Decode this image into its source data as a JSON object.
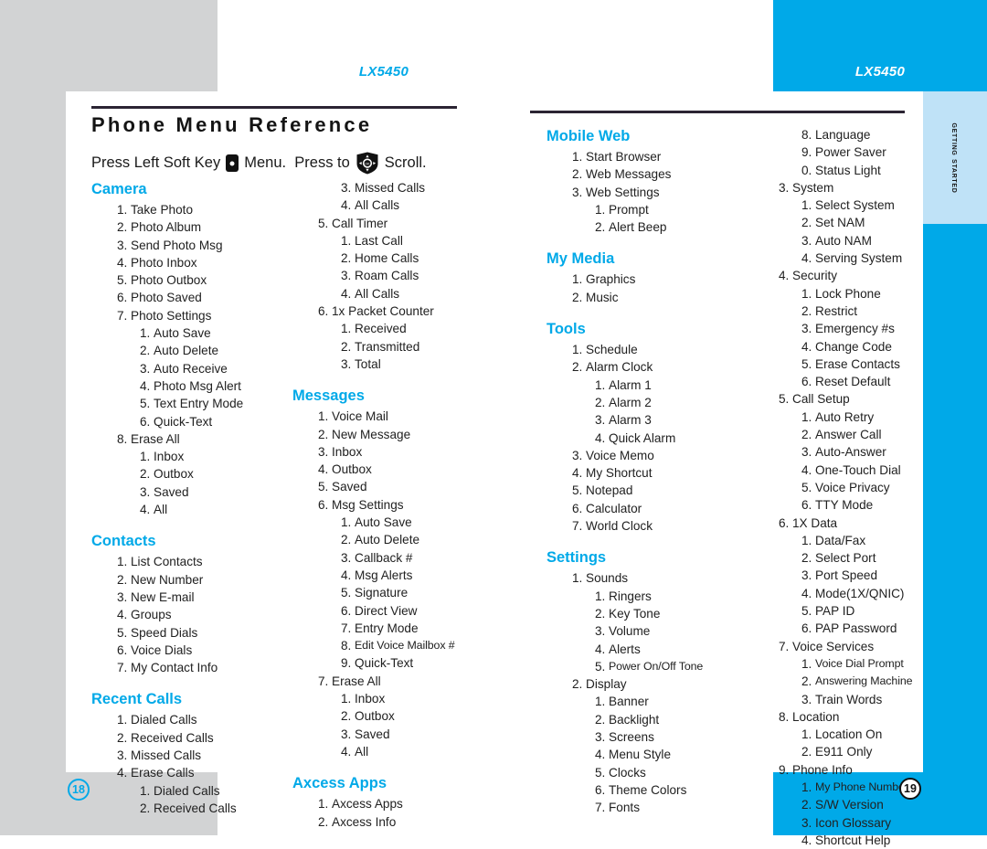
{
  "document": {
    "title": "Phone Menu Reference",
    "header_left": "LX5450",
    "header_right": "LX5450",
    "side_tab": "Getting Started",
    "page_left": "18",
    "page_right": "19",
    "accent_color": "#00a9e8",
    "gray_color": "#d2d3d4",
    "light_tab_color": "#bfe2f7",
    "text_color": "#212121"
  },
  "instruction": {
    "part1": "Press Left Soft Key",
    "icon1": "soft-key-icon",
    "part2": "Menu.  Press to",
    "icon2": "navigation-pad-icon",
    "part3": "Scroll."
  },
  "column_a": [
    {
      "type": "head",
      "text": "Camera"
    },
    {
      "type": "l1",
      "num": "1.",
      "label": "Take Photo"
    },
    {
      "type": "l1",
      "num": "2.",
      "label": "Photo Album"
    },
    {
      "type": "l1",
      "num": "3.",
      "label": "Send Photo Msg"
    },
    {
      "type": "l1",
      "num": "4.",
      "label": "Photo Inbox"
    },
    {
      "type": "l1",
      "num": "5.",
      "label": "Photo Outbox"
    },
    {
      "type": "l1",
      "num": "6.",
      "label": "Photo  Saved"
    },
    {
      "type": "l1",
      "num": "7.",
      "label": "Photo Settings"
    },
    {
      "type": "l2",
      "num": "1.",
      "label": "Auto Save"
    },
    {
      "type": "l2",
      "num": "2.",
      "label": "Auto Delete"
    },
    {
      "type": "l2",
      "num": "3.",
      "label": "Auto Receive"
    },
    {
      "type": "l2",
      "num": "4.",
      "label": "Photo Msg Alert"
    },
    {
      "type": "l2",
      "num": "5.",
      "label": "Text Entry Mode"
    },
    {
      "type": "l2",
      "num": "6.",
      "label": "Quick-Text"
    },
    {
      "type": "l1",
      "num": "8.",
      "label": "Erase All"
    },
    {
      "type": "l2",
      "num": "1.",
      "label": "Inbox"
    },
    {
      "type": "l2",
      "num": "2.",
      "label": "Outbox"
    },
    {
      "type": "l2",
      "num": "3.",
      "label": "Saved"
    },
    {
      "type": "l2",
      "num": "4.",
      "label": "All"
    },
    {
      "type": "head",
      "text": "Contacts"
    },
    {
      "type": "l1",
      "num": "1.",
      "label": "List Contacts"
    },
    {
      "type": "l1",
      "num": "2.",
      "label": "New Number"
    },
    {
      "type": "l1",
      "num": "3.",
      "label": "New E-mail"
    },
    {
      "type": "l1",
      "num": "4.",
      "label": "Groups"
    },
    {
      "type": "l1",
      "num": "5.",
      "label": "Speed Dials"
    },
    {
      "type": "l1",
      "num": "6.",
      "label": "Voice Dials"
    },
    {
      "type": "l1",
      "num": "7.",
      "label": "My Contact Info"
    },
    {
      "type": "head",
      "text": "Recent Calls"
    },
    {
      "type": "l1",
      "num": "1.",
      "label": "Dialed Calls"
    },
    {
      "type": "l1",
      "num": "2.",
      "label": "Received Calls"
    },
    {
      "type": "l1",
      "num": "3.",
      "label": "Missed Calls"
    },
    {
      "type": "l1",
      "num": "4.",
      "label": "Erase Calls"
    },
    {
      "type": "l2",
      "num": "1.",
      "label": "Dialed Calls"
    },
    {
      "type": "l2",
      "num": "2.",
      "label": "Received Calls"
    }
  ],
  "column_b": [
    {
      "type": "l2",
      "num": "3.",
      "label": "Missed Calls"
    },
    {
      "type": "l2",
      "num": "4.",
      "label": "All Calls"
    },
    {
      "type": "l1",
      "num": "5.",
      "label": "Call Timer"
    },
    {
      "type": "l2",
      "num": "1.",
      "label": "Last Call"
    },
    {
      "type": "l2",
      "num": "2.",
      "label": "Home Calls"
    },
    {
      "type": "l2",
      "num": "3.",
      "label": "Roam Calls"
    },
    {
      "type": "l2",
      "num": "4.",
      "label": "All Calls"
    },
    {
      "type": "l1",
      "num": "6.",
      "label": "1x Packet Counter"
    },
    {
      "type": "l2",
      "num": "1.",
      "label": "Received"
    },
    {
      "type": "l2",
      "num": "2.",
      "label": "Transmitted"
    },
    {
      "type": "l2",
      "num": "3.",
      "label": "Total"
    },
    {
      "type": "head",
      "text": "Messages"
    },
    {
      "type": "l1",
      "num": "1.",
      "label": "Voice Mail"
    },
    {
      "type": "l1",
      "num": "2.",
      "label": "New Message"
    },
    {
      "type": "l1",
      "num": "3.",
      "label": "Inbox"
    },
    {
      "type": "l1",
      "num": "4.",
      "label": "Outbox"
    },
    {
      "type": "l1",
      "num": "5.",
      "label": "Saved"
    },
    {
      "type": "l1",
      "num": "6.",
      "label": "Msg Settings"
    },
    {
      "type": "l2",
      "num": "1.",
      "label": "Auto Save"
    },
    {
      "type": "l2",
      "num": "2.",
      "label": "Auto Delete"
    },
    {
      "type": "l2",
      "num": "3.",
      "label": "Callback #"
    },
    {
      "type": "l2",
      "num": "4.",
      "label": "Msg Alerts"
    },
    {
      "type": "l2",
      "num": "5.",
      "label": "Signature"
    },
    {
      "type": "l2",
      "num": "6.",
      "label": "Direct View"
    },
    {
      "type": "l2",
      "num": "7.",
      "label": "Entry Mode"
    },
    {
      "type": "l2",
      "num": "8.",
      "label": "Edit Voice Mailbox #",
      "tight": true
    },
    {
      "type": "l2",
      "num": "9.",
      "label": "Quick-Text"
    },
    {
      "type": "l1",
      "num": "7.",
      "label": "Erase All"
    },
    {
      "type": "l2",
      "num": "1.",
      "label": "Inbox"
    },
    {
      "type": "l2",
      "num": "2.",
      "label": "Outbox"
    },
    {
      "type": "l2",
      "num": "3.",
      "label": "Saved"
    },
    {
      "type": "l2",
      "num": "4.",
      "label": "All"
    },
    {
      "type": "head",
      "text": "Axcess Apps"
    },
    {
      "type": "l1",
      "num": "1.",
      "label": "Axcess Apps"
    },
    {
      "type": "l1",
      "num": "2.",
      "label": "Axcess Info"
    }
  ],
  "column_c": [
    {
      "type": "head",
      "text": "Mobile Web"
    },
    {
      "type": "l1",
      "num": "1.",
      "label": "Start Browser"
    },
    {
      "type": "l1",
      "num": "2.",
      "label": "Web Messages"
    },
    {
      "type": "l1",
      "num": "3.",
      "label": "Web Settings"
    },
    {
      "type": "l2",
      "num": "1.",
      "label": "Prompt"
    },
    {
      "type": "l2",
      "num": "2.",
      "label": "Alert Beep"
    },
    {
      "type": "head",
      "text": "My Media"
    },
    {
      "type": "l1",
      "num": "1.",
      "label": "Graphics"
    },
    {
      "type": "l1",
      "num": "2.",
      "label": "Music"
    },
    {
      "type": "head",
      "text": "Tools"
    },
    {
      "type": "l1",
      "num": "1.",
      "label": "Schedule"
    },
    {
      "type": "l1",
      "num": "2.",
      "label": "Alarm Clock"
    },
    {
      "type": "l2",
      "num": "1.",
      "label": "Alarm 1"
    },
    {
      "type": "l2",
      "num": "2.",
      "label": "Alarm 2"
    },
    {
      "type": "l2",
      "num": "3.",
      "label": "Alarm 3"
    },
    {
      "type": "l2",
      "num": "4.",
      "label": "Quick Alarm"
    },
    {
      "type": "l1",
      "num": "3.",
      "label": "Voice Memo"
    },
    {
      "type": "l1",
      "num": "4.",
      "label": "My Shortcut"
    },
    {
      "type": "l1",
      "num": "5.",
      "label": "Notepad"
    },
    {
      "type": "l1",
      "num": "6.",
      "label": "Calculator"
    },
    {
      "type": "l1",
      "num": "7.",
      "label": "World Clock"
    },
    {
      "type": "head",
      "text": "Settings"
    },
    {
      "type": "l1",
      "num": "1.",
      "label": "Sounds"
    },
    {
      "type": "l2",
      "num": "1.",
      "label": "Ringers"
    },
    {
      "type": "l2",
      "num": "2.",
      "label": "Key Tone"
    },
    {
      "type": "l2",
      "num": "3.",
      "label": "Volume"
    },
    {
      "type": "l2",
      "num": "4.",
      "label": "Alerts"
    },
    {
      "type": "l2",
      "num": "5.",
      "label": "Power On/Off Tone",
      "tight": true
    },
    {
      "type": "l1",
      "num": "2.",
      "label": "Display"
    },
    {
      "type": "l2",
      "num": "1.",
      "label": "Banner"
    },
    {
      "type": "l2",
      "num": "2.",
      "label": "Backlight"
    },
    {
      "type": "l2",
      "num": "3.",
      "label": "Screens"
    },
    {
      "type": "l2",
      "num": "4.",
      "label": "Menu Style"
    },
    {
      "type": "l2",
      "num": "5.",
      "label": "Clocks"
    },
    {
      "type": "l2",
      "num": "6.",
      "label": "Theme Colors"
    },
    {
      "type": "l2",
      "num": "7.",
      "label": "Fonts"
    }
  ],
  "column_d": [
    {
      "type": "l2",
      "num": "8.",
      "label": "Language"
    },
    {
      "type": "l2",
      "num": "9.",
      "label": "Power Saver"
    },
    {
      "type": "l2",
      "num": "0.",
      "label": "Status Light"
    },
    {
      "type": "l1",
      "num": "3.",
      "label": "System"
    },
    {
      "type": "l2",
      "num": "1.",
      "label": "Select System"
    },
    {
      "type": "l2",
      "num": "2.",
      "label": "Set NAM"
    },
    {
      "type": "l2",
      "num": "3.",
      "label": "Auto NAM"
    },
    {
      "type": "l2",
      "num": "4.",
      "label": "Serving System"
    },
    {
      "type": "l1",
      "num": "4.",
      "label": "Security"
    },
    {
      "type": "l2",
      "num": "1.",
      "label": "Lock Phone"
    },
    {
      "type": "l2",
      "num": "2.",
      "label": "Restrict"
    },
    {
      "type": "l2",
      "num": "3.",
      "label": "Emergency #s"
    },
    {
      "type": "l2",
      "num": "4.",
      "label": "Change Code"
    },
    {
      "type": "l2",
      "num": "5.",
      "label": "Erase Contacts"
    },
    {
      "type": "l2",
      "num": "6.",
      "label": "Reset Default"
    },
    {
      "type": "l1",
      "num": "5.",
      "label": "Call Setup"
    },
    {
      "type": "l2",
      "num": "1.",
      "label": "Auto Retry"
    },
    {
      "type": "l2",
      "num": "2.",
      "label": "Answer Call"
    },
    {
      "type": "l2",
      "num": "3.",
      "label": "Auto-Answer"
    },
    {
      "type": "l2",
      "num": "4.",
      "label": "One-Touch Dial"
    },
    {
      "type": "l2",
      "num": "5.",
      "label": "Voice Privacy"
    },
    {
      "type": "l2",
      "num": "6.",
      "label": "TTY Mode"
    },
    {
      "type": "l1",
      "num": "6.",
      "label": "1X Data"
    },
    {
      "type": "l2",
      "num": "1.",
      "label": "Data/Fax"
    },
    {
      "type": "l2",
      "num": "2.",
      "label": "Select Port"
    },
    {
      "type": "l2",
      "num": "3.",
      "label": "Port Speed"
    },
    {
      "type": "l2",
      "num": "4.",
      "label": "Mode(1X/QNIC)"
    },
    {
      "type": "l2",
      "num": "5.",
      "label": "PAP ID"
    },
    {
      "type": "l2",
      "num": "6.",
      "label": "PAP Password"
    },
    {
      "type": "l1",
      "num": "7.",
      "label": "Voice Services"
    },
    {
      "type": "l2",
      "num": "1.",
      "label": "Voice Dial Prompt",
      "tight": true
    },
    {
      "type": "l2",
      "num": "2.",
      "label": "Answering Machine",
      "tight": true
    },
    {
      "type": "l2",
      "num": "3.",
      "label": "Train Words"
    },
    {
      "type": "l1",
      "num": "8.",
      "label": "Location"
    },
    {
      "type": "l2",
      "num": "1.",
      "label": "Location On"
    },
    {
      "type": "l2",
      "num": "2.",
      "label": "E911 Only"
    },
    {
      "type": "l1",
      "num": "9.",
      "label": "Phone Info"
    },
    {
      "type": "l2",
      "num": "1.",
      "label": "My Phone Number",
      "tight": true
    },
    {
      "type": "l2",
      "num": "2.",
      "label": "S/W Version"
    },
    {
      "type": "l2",
      "num": "3.",
      "label": "Icon Glossary"
    },
    {
      "type": "l2",
      "num": "4.",
      "label": "Shortcut Help"
    }
  ]
}
